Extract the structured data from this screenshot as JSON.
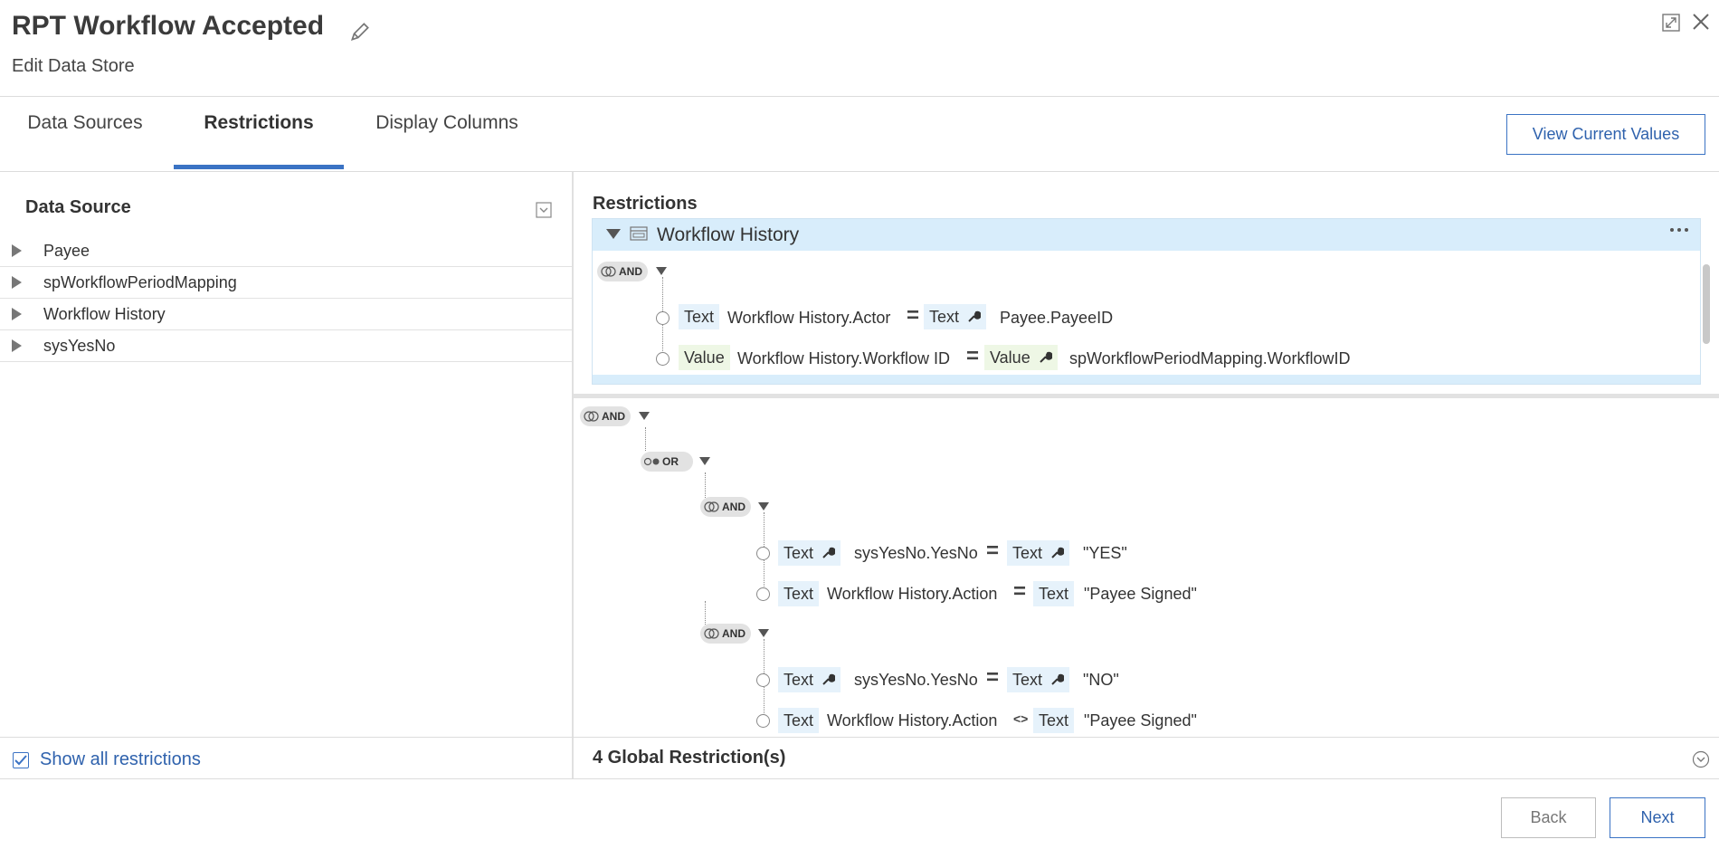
{
  "header": {
    "title": "RPT Workflow Accepted",
    "subtitle": "Edit Data Store"
  },
  "tabs": [
    {
      "label": "Data Sources",
      "active": false
    },
    {
      "label": "Restrictions",
      "active": true
    },
    {
      "label": "Display Columns",
      "active": false
    }
  ],
  "view_current_values_label": "View Current Values",
  "data_source_panel": {
    "title": "Data Source",
    "items": [
      "Payee",
      "spWorkflowPeriodMapping",
      "Workflow History",
      "sysYesNo"
    ]
  },
  "restrictions_panel": {
    "title": "Restrictions",
    "section_title": "Workflow History",
    "section_group": "AND",
    "rows": [
      {
        "left_type": "Text",
        "left_field": "Workflow History.Actor",
        "op": "=",
        "right_type": "Text",
        "right_value": "Payee.PayeeID"
      },
      {
        "left_type": "Value",
        "left_field": "Workflow History.Workflow ID",
        "op": "=",
        "right_type": "Value",
        "right_value": "spWorkflowPeriodMapping.WorkflowID"
      }
    ]
  },
  "global_tree": {
    "root": "AND",
    "or_group": "OR",
    "group_a": {
      "label": "AND",
      "rows": [
        {
          "left_type": "Text",
          "left_field": "sysYesNo.YesNo",
          "op": "=",
          "right_type": "Text",
          "right_value": "\"YES\""
        },
        {
          "left_type": "Text",
          "left_field": "Workflow History.Action",
          "op": "=",
          "right_type": "Text",
          "right_value": "\"Payee Signed\""
        }
      ]
    },
    "group_b": {
      "label": "AND",
      "rows": [
        {
          "left_type": "Text",
          "left_field": "sysYesNo.YesNo",
          "op": "=",
          "right_type": "Text",
          "right_value": "\"NO\""
        },
        {
          "left_type": "Text",
          "left_field": "Workflow History.Action",
          "op": "<>",
          "right_type": "Text",
          "right_value": "\"Payee Signed\""
        }
      ]
    }
  },
  "footer": {
    "show_all_label": "Show all restrictions",
    "show_all_checked": true,
    "global_label": "4 Global Restriction(s)",
    "back_label": "Back",
    "next_label": "Next"
  }
}
